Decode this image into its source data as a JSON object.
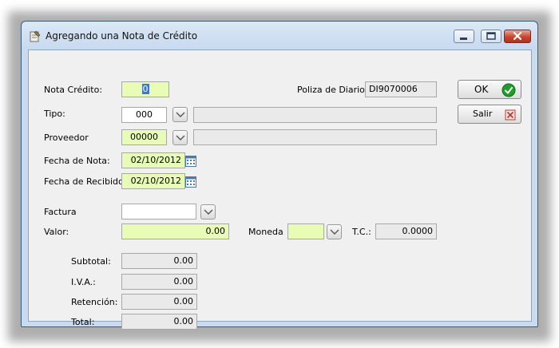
{
  "window": {
    "title": "Agregando una Nota de Crédito",
    "icon": "notepad-icon"
  },
  "form": {
    "nota_credito": {
      "label": "Nota Crédito:",
      "value": "0"
    },
    "poliza": {
      "label": "Poliza de Diario:",
      "value": "DI9070006"
    },
    "tipo": {
      "label": "Tipo:",
      "value": "000",
      "description": ""
    },
    "proveedor": {
      "label": "Proveedor",
      "value": "00000",
      "description": ""
    },
    "fecha_nota": {
      "label": "Fecha de Nota:",
      "value": "02/10/2012"
    },
    "fecha_recibido": {
      "label": "Fecha de Recibido:",
      "value": "02/10/2012"
    },
    "factura": {
      "label": "Factura",
      "value": ""
    },
    "valor": {
      "label": "Valor:",
      "value": "0.00"
    },
    "moneda": {
      "label": "Moneda",
      "value": ""
    },
    "tc": {
      "label": "T.C.:",
      "value": "0.0000"
    },
    "subtotal": {
      "label": "Subtotal:",
      "value": "0.00"
    },
    "iva": {
      "label": "I.V.A.:",
      "value": "0.00"
    },
    "retencion": {
      "label": "Retención:",
      "value": "0.00"
    },
    "total": {
      "label": "Total:",
      "value": "0.00"
    }
  },
  "buttons": {
    "ok": {
      "label": "OK",
      "icon": "check-icon",
      "icon_color": "#1f9e2c"
    },
    "salir": {
      "label": "Salir",
      "icon": "close-x-icon",
      "icon_color": "#c0392b"
    }
  },
  "colors": {
    "required_field": "#e9fcb6",
    "readonly_field": "#eaeaea",
    "selection": "#3c79d2"
  }
}
